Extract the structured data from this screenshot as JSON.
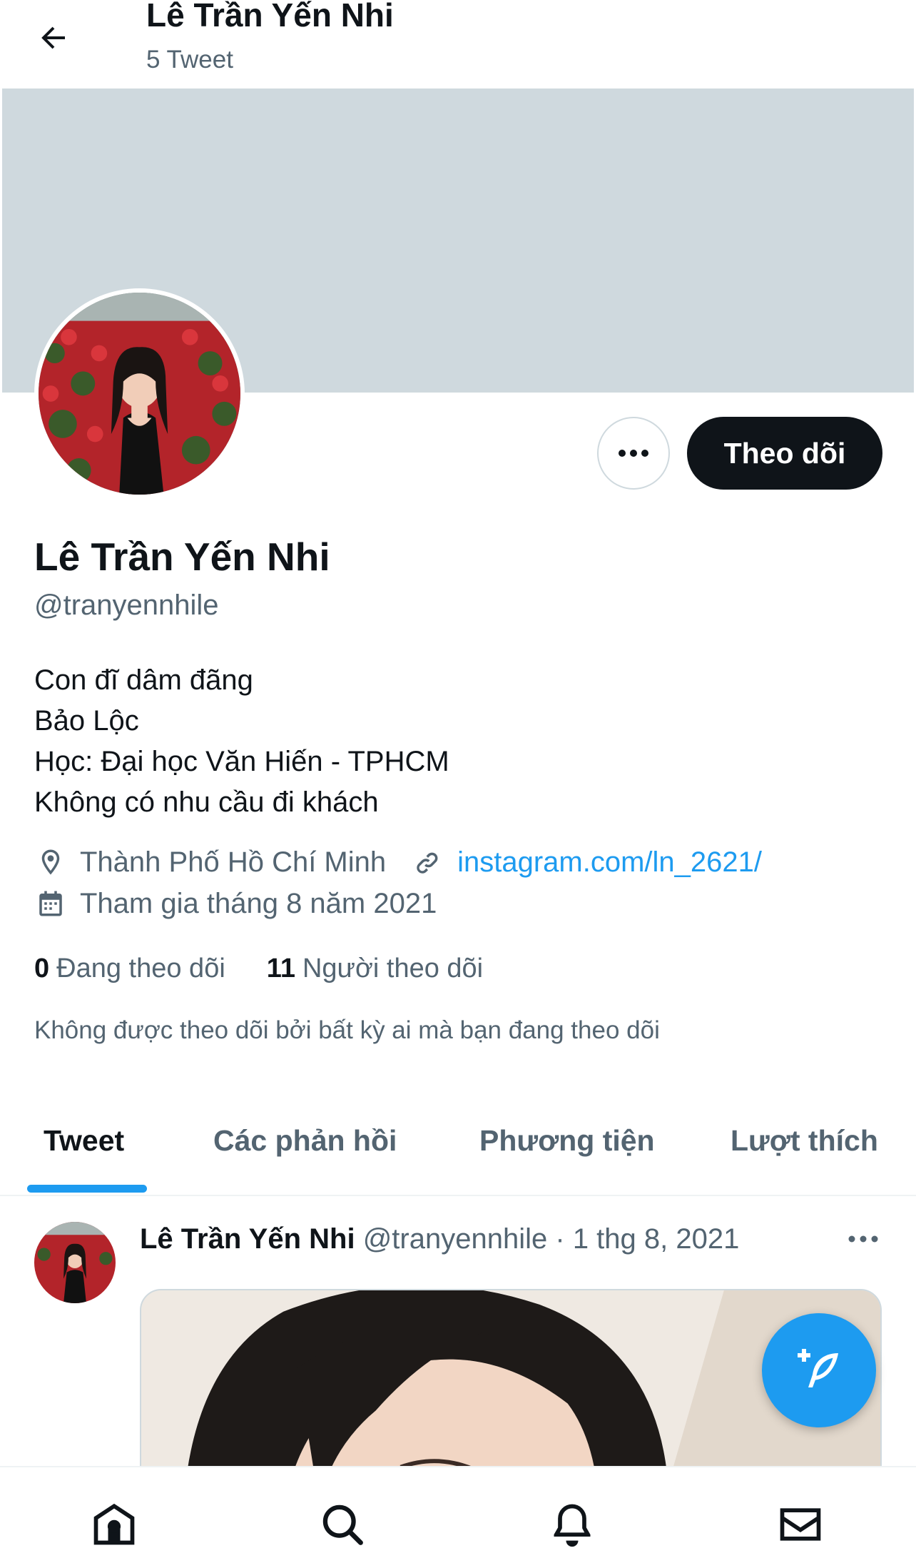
{
  "header": {
    "title": "Lê Trần Yến Nhi",
    "tweet_count": "5 Tweet"
  },
  "profile": {
    "display_name": "Lê Trần Yến Nhi",
    "handle": "@tranyennhile",
    "follow_label": "Theo dõi",
    "bio": [
      "Con đĩ dâm đãng",
      "Bảo Lộc",
      "Học: Đại học Văn Hiến - TPHCM",
      "Không có nhu cầu đi khách"
    ],
    "location": "Thành Phố Hồ Chí Minh",
    "link": "instagram.com/ln_2621/",
    "joined": "Tham gia tháng 8 năm 2021",
    "following_count": "0",
    "following_label": "Đang theo dõi",
    "followers_count": "11",
    "followers_label": "Người theo dõi",
    "followed_by_note": "Không được theo dõi bởi bất kỳ ai mà bạn đang theo dõi"
  },
  "tabs": [
    {
      "label": "Tweet",
      "active": true
    },
    {
      "label": "Các phản hồi",
      "active": false
    },
    {
      "label": "Phương tiện",
      "active": false
    },
    {
      "label": "Lượt thích",
      "active": false
    }
  ],
  "tweet": {
    "author_name": "Lê Trần Yến Nhi",
    "author_handle": "@tranyennhile",
    "separator": "·",
    "date": "1 thg 8, 2021"
  },
  "icons": {
    "back": "arrow-left-icon",
    "more": "more-horizontal-icon",
    "location": "location-pin-icon",
    "link": "link-icon",
    "calendar": "calendar-icon",
    "compose": "compose-tweet-icon",
    "nav_home": "home-icon",
    "nav_search": "search-icon",
    "nav_notifications": "bell-icon",
    "nav_messages": "mail-icon"
  },
  "colors": {
    "accent": "#1d9bf0",
    "text_primary": "#0f1419",
    "text_secondary": "#536471",
    "banner": "#cfd9de"
  }
}
